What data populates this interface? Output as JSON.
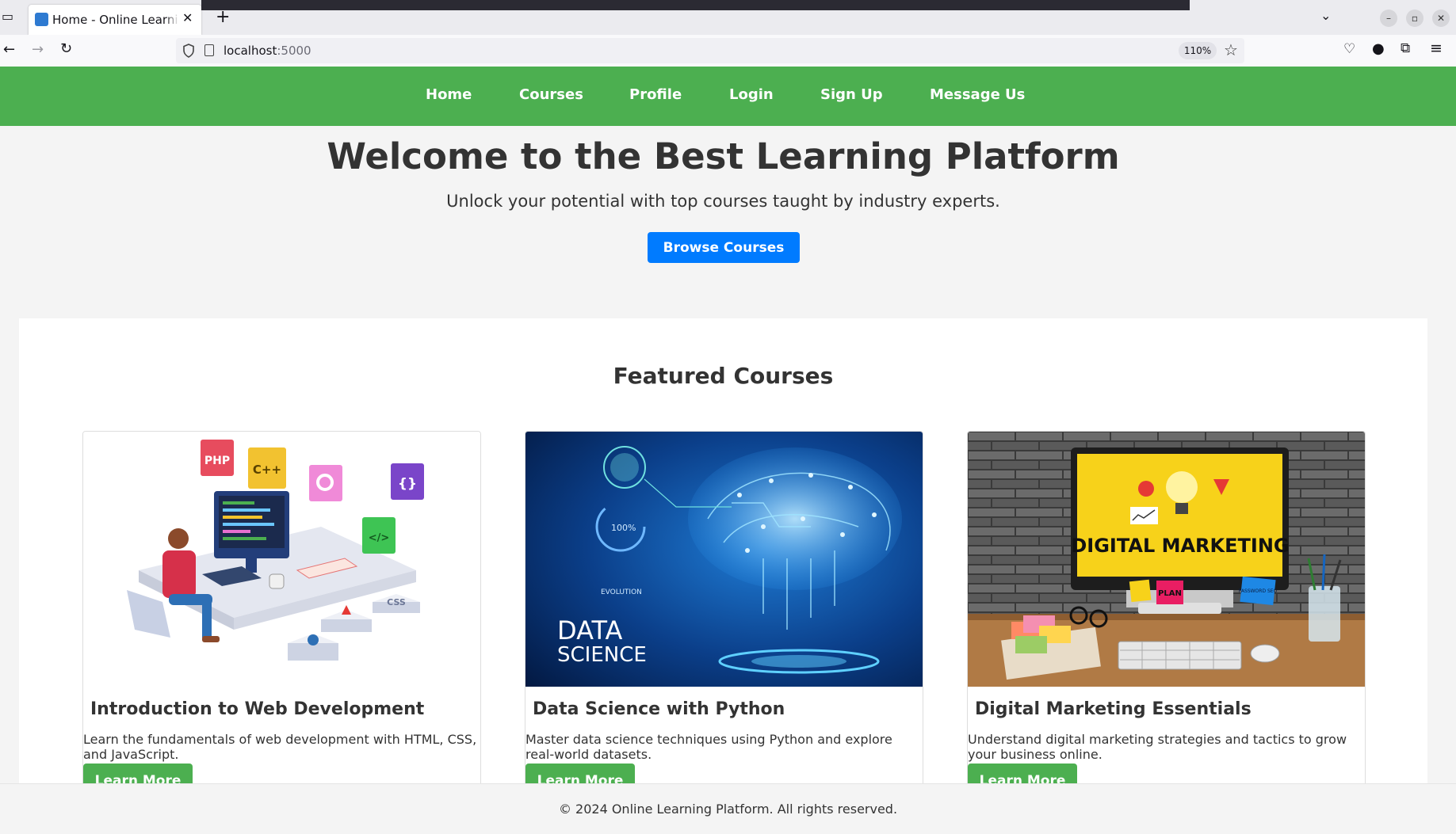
{
  "browser": {
    "tab_title": "Home - Online Learning Platform",
    "url_host": "localhost",
    "url_port": ":5000",
    "zoom": "110%"
  },
  "nav": {
    "items": [
      {
        "label": "Home"
      },
      {
        "label": "Courses"
      },
      {
        "label": "Profile"
      },
      {
        "label": "Login"
      },
      {
        "label": "Sign Up"
      },
      {
        "label": "Message Us"
      }
    ]
  },
  "hero": {
    "title": "Welcome to the Best Learning Platform",
    "subtitle": "Unlock your potential with top courses taught by industry experts.",
    "button": "Browse Courses"
  },
  "featured": {
    "title": "Featured Courses",
    "courses": [
      {
        "title": "Introduction to Web Development",
        "description": "Learn the fundamentals of web development with HTML, CSS, and JavaScript.",
        "button": "Learn More",
        "image_labels": [
          "PHP",
          "C++",
          "{}",
          "</>",
          "CSS"
        ]
      },
      {
        "title": "Data Science with Python",
        "description": "Master data science techniques using Python and explore real-world datasets.",
        "button": "Learn More",
        "image_labels": [
          "DATA",
          "SCIENCE",
          "100%",
          "EVOLUTION"
        ]
      },
      {
        "title": "Digital Marketing Essentials",
        "description": "Understand digital marketing strategies and tactics to grow your business online.",
        "button": "Learn More",
        "image_labels": [
          "DIGITAL MARKETING",
          "PLAN",
          "PASSWORD SEO"
        ]
      }
    ]
  },
  "footer": {
    "text": "© 2024 Online Learning Platform. All rights reserved."
  },
  "colors": {
    "nav_green": "#4caf50",
    "primary_blue": "#007bff",
    "text_dark": "#333333"
  }
}
